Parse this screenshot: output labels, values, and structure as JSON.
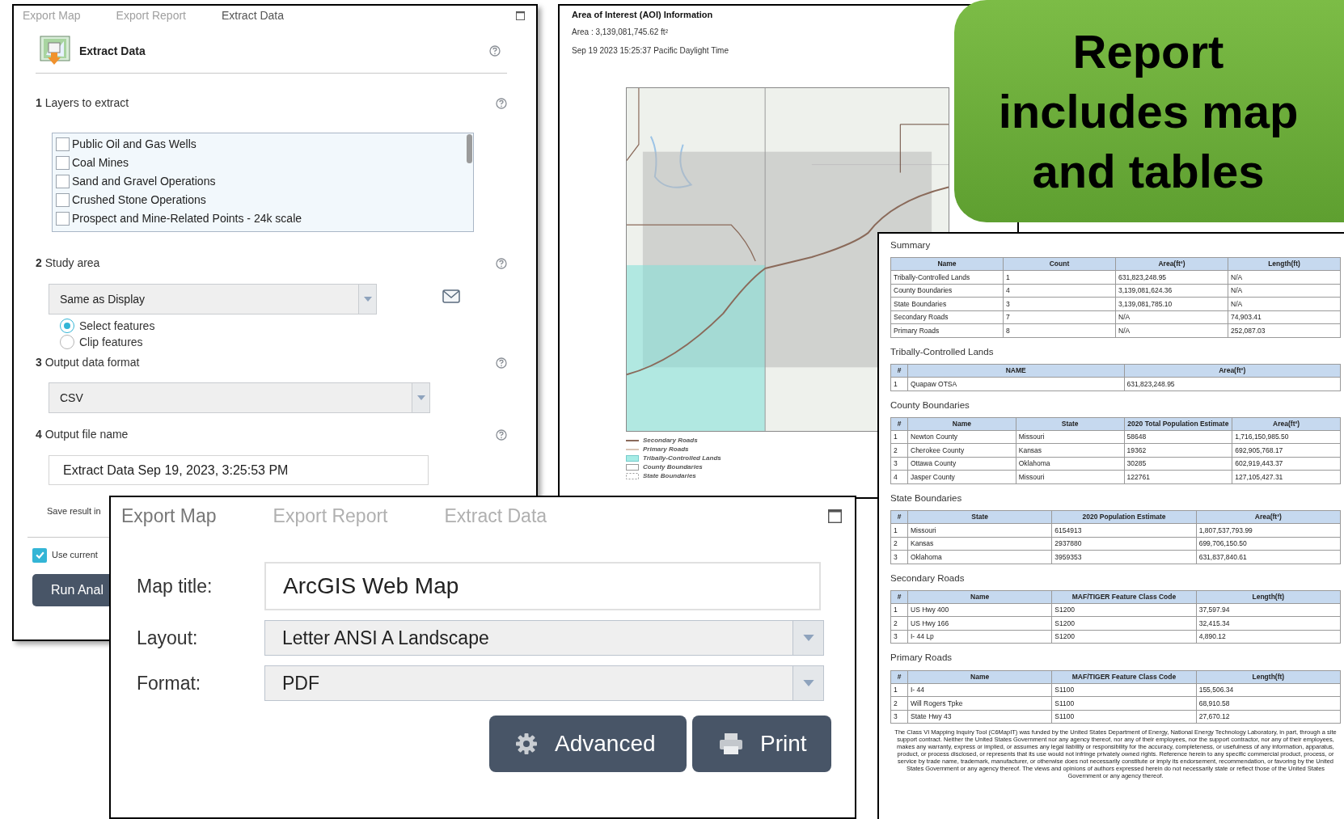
{
  "extract_panel": {
    "tabs": [
      {
        "label": "Export Map",
        "selected": false
      },
      {
        "label": "Export Report",
        "selected": false
      },
      {
        "label": "Extract Data",
        "selected": true
      }
    ],
    "header": "Extract Data",
    "layers_step": {
      "number": "1",
      "label": "Layers to extract",
      "layers": [
        {
          "label": "Public Oil and Gas Wells",
          "checked": false
        },
        {
          "label": "Coal Mines",
          "checked": false
        },
        {
          "label": "Sand and Gravel Operations",
          "checked": false
        },
        {
          "label": "Crushed Stone Operations",
          "checked": false
        },
        {
          "label": "Prospect and Mine-Related Points - 24k scale",
          "checked": false
        }
      ]
    },
    "study_area_step": {
      "number": "2",
      "label": "Study area",
      "dropdown": "Same as Display",
      "options": [
        {
          "label": "Select features",
          "selected": true
        },
        {
          "label": "Clip features",
          "selected": false
        }
      ]
    },
    "format_step": {
      "number": "3",
      "label": "Output data format",
      "dropdown": "CSV"
    },
    "file_name_step": {
      "number": "4",
      "label": "Output file name",
      "value": "Extract Data Sep 19, 2023, 3:25:53 PM"
    },
    "save_result_text": "Save result in",
    "use_current": {
      "label": "Use current",
      "checked": true
    },
    "run_button": "Run Anal"
  },
  "report_page": {
    "title": "Area of Interest (AOI) Information",
    "area": "Area : 3,139,081,745.62 ft²",
    "timestamp": "Sep 19 2023 15:25:37 Pacific Daylight Time",
    "legend": [
      {
        "label": "Secondary Roads",
        "kind": "thick-line"
      },
      {
        "label": "Primary Roads",
        "kind": "thin-line"
      },
      {
        "label": "Tribally-Controlled Lands",
        "kind": "fill"
      },
      {
        "label": "County Boundaries",
        "kind": "outline"
      },
      {
        "label": "State Boundaries",
        "kind": "dashed"
      }
    ]
  },
  "callout": {
    "text": "Report includes map and tables"
  },
  "report_tables": [
    {
      "title": "Summary",
      "columns": [
        "Name",
        "Count",
        "Area(ft²)",
        "Length(ft)"
      ],
      "rows": [
        [
          "Tribally-Controlled Lands",
          "1",
          "631,823,248.95",
          "N/A"
        ],
        [
          "County Boundaries",
          "4",
          "3,139,081,624.36",
          "N/A"
        ],
        [
          "State Boundaries",
          "3",
          "3,139,081,785.10",
          "N/A"
        ],
        [
          "Secondary Roads",
          "7",
          "N/A",
          "74,903.41"
        ],
        [
          "Primary Roads",
          "8",
          "N/A",
          "252,087.03"
        ]
      ]
    },
    {
      "title": "Tribally-Controlled Lands",
      "columns": [
        "#",
        "NAME",
        "Area(ft²)"
      ],
      "rows": [
        [
          "1",
          "Quapaw OTSA",
          "631,823,248.95"
        ]
      ]
    },
    {
      "title": "County Boundaries",
      "columns": [
        "#",
        "Name",
        "State",
        "2020 Total Population Estimate",
        "Area(ft²)"
      ],
      "rows": [
        [
          "1",
          "Newton County",
          "Missouri",
          "58648",
          "1,716,150,985.50"
        ],
        [
          "2",
          "Cherokee County",
          "Kansas",
          "19362",
          "692,905,768.17"
        ],
        [
          "3",
          "Ottawa County",
          "Oklahoma",
          "30285",
          "602,919,443.37"
        ],
        [
          "4",
          "Jasper County",
          "Missouri",
          "122761",
          "127,105,427.31"
        ]
      ]
    },
    {
      "title": "State Boundaries",
      "columns": [
        "#",
        "State",
        "2020 Population Estimate",
        "Area(ft²)"
      ],
      "rows": [
        [
          "1",
          "Missouri",
          "6154913",
          "1,807,537,793.99"
        ],
        [
          "2",
          "Kansas",
          "2937880",
          "699,706,150.50"
        ],
        [
          "3",
          "Oklahoma",
          "3959353",
          "631,837,840.61"
        ]
      ]
    },
    {
      "title": "Secondary Roads",
      "columns": [
        "#",
        "Name",
        "MAF/TIGER Feature Class Code",
        "Length(ft)"
      ],
      "rows": [
        [
          "1",
          "US Hwy 400",
          "S1200",
          "37,597.94"
        ],
        [
          "2",
          "US Hwy 166",
          "S1200",
          "32,415.34"
        ],
        [
          "3",
          "I- 44 Lp",
          "S1200",
          "4,890.12"
        ]
      ]
    },
    {
      "title": "Primary Roads",
      "columns": [
        "#",
        "Name",
        "MAF/TIGER Feature Class Code",
        "Length(ft)"
      ],
      "rows": [
        [
          "1",
          "I- 44",
          "S1100",
          "155,506.34"
        ],
        [
          "2",
          "Will Rogers Tpke",
          "S1100",
          "68,910.58"
        ],
        [
          "3",
          "State Hwy 43",
          "S1100",
          "27,670.12"
        ]
      ]
    }
  ],
  "disclaimer": "The Class VI Mapping Inquiry Tool (C6MapIT) was funded by the United States Department of Energy, National Energy Technology Laboratory, in part, through a site support contract. Neither the United States Government nor any agency thereof, nor any of their employees, nor the support contractor, nor any of their employees, makes any warranty, express or implied, or assumes any legal liability or responsibility for the accuracy, completeness, or usefulness of any information, apparatus, product, or process disclosed, or represents that its use would not infringe privately owned rights.  Reference herein to any specific commercial product, process, or service by trade name, trademark, manufacturer, or otherwise does not necessarily constitute or imply its endorsement, recommendation, or favoring by the United States Government or any agency thereof. The views and opinions of authors expressed herein do not necessarily state or reflect those of the United States Government or any agency thereof.",
  "export_dialog": {
    "tabs": [
      {
        "label": "Export Map",
        "selected": true
      },
      {
        "label": "Export Report",
        "selected": false
      },
      {
        "label": "Extract Data",
        "selected": false
      }
    ],
    "fields": [
      {
        "label": "Map title:",
        "kind": "text",
        "value": "ArcGIS Web Map"
      },
      {
        "label": "Layout:",
        "kind": "select",
        "value": "Letter ANSI A Landscape"
      },
      {
        "label": "Format:",
        "kind": "select",
        "value": "PDF"
      }
    ],
    "buttons": [
      {
        "label": "Advanced",
        "kind": "gear"
      },
      {
        "label": "Print",
        "kind": "printer"
      }
    ]
  }
}
